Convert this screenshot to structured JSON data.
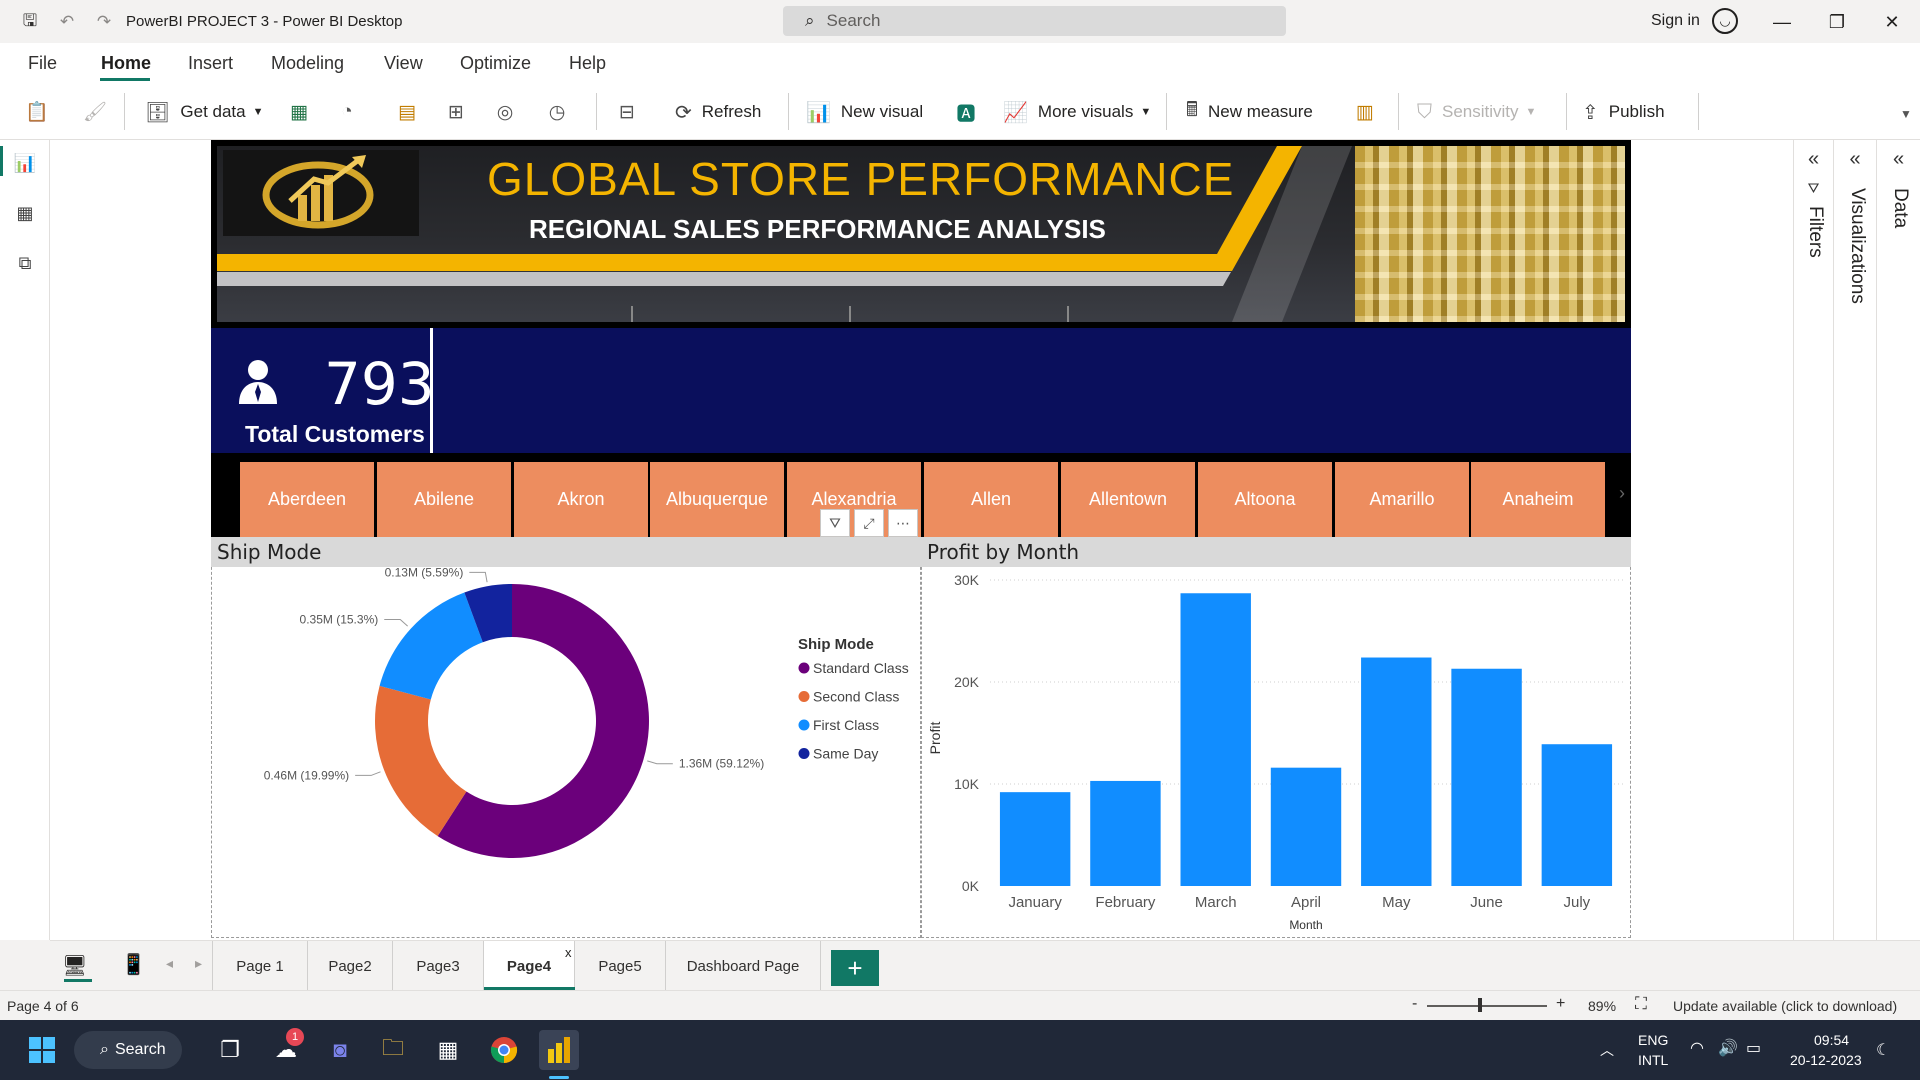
{
  "titlebar": {
    "title": "PowerBI PROJECT 3 - Power BI Desktop",
    "search_placeholder": "Search",
    "sign_in": "Sign in"
  },
  "menu": {
    "tabs": [
      "File",
      "Home",
      "Insert",
      "Modeling",
      "View",
      "Optimize",
      "Help"
    ],
    "active": "Home"
  },
  "ribbon": {
    "get_data": "Get data",
    "refresh": "Refresh",
    "new_visual": "New visual",
    "more_visuals": "More visuals",
    "new_measure": "New measure",
    "sensitivity": "Sensitivity",
    "publish": "Publish"
  },
  "banner": {
    "title": "GLOBAL STORE PERFORMANCE",
    "subtitle": "REGIONAL SALES PERFORMANCE ANALYSIS",
    "colors": {
      "gold": "#f4b400",
      "dark": "#1f2023"
    }
  },
  "kpi": {
    "value": "793",
    "label": "Total Customers",
    "color": "#0a0f5c"
  },
  "slicer": {
    "cities": [
      "Aberdeen",
      "Abilene",
      "Akron",
      "Albuquerque",
      "Alexandria",
      "Allen",
      "Allentown",
      "Altoona",
      "Amarillo",
      "Anaheim"
    ],
    "button_color": "#ed8d5f"
  },
  "ship_mode": {
    "title": "Ship Mode",
    "legend_title": "Ship Mode"
  },
  "profit_chart": {
    "title": "Profit by Month"
  },
  "chart_data": [
    {
      "type": "pie",
      "title": "Ship Mode",
      "series": [
        {
          "name": "Standard Class",
          "value": 1.36,
          "label": "1.36M (59.12%)",
          "color": "#6b007b"
        },
        {
          "name": "Second Class",
          "value": 0.46,
          "label": "0.46M (19.99%)",
          "color": "#e66c37"
        },
        {
          "name": "First Class",
          "value": 0.35,
          "label": "0.35M (15.3%)",
          "color": "#118dff"
        },
        {
          "name": "Same Day",
          "value": 0.13,
          "label": "0.13M (5.59%)",
          "color": "#12239e"
        }
      ],
      "legend": "right"
    },
    {
      "type": "bar",
      "title": "Profit by Month",
      "categories": [
        "January",
        "February",
        "March",
        "April",
        "May",
        "June",
        "July"
      ],
      "values": [
        9200,
        10300,
        28700,
        11600,
        22400,
        21300,
        13900
      ],
      "xlabel": "Month",
      "ylabel": "Profit",
      "ylim": [
        0,
        30000
      ],
      "yticks": [
        "0K",
        "10K",
        "20K",
        "30K"
      ],
      "color": "#118dff",
      "grid": true
    }
  ],
  "panes": {
    "filters": "Filters",
    "visualizations": "Visualizations",
    "data": "Data"
  },
  "pages": {
    "tabs": [
      "Page 1",
      "Page2",
      "Page3",
      "Page4",
      "Page5",
      "Dashboard Page"
    ],
    "active": "Page4",
    "close": "x",
    "add": "+"
  },
  "status": {
    "page_info": "Page 4 of 6",
    "zoom": "89%",
    "zoom_minus": "-",
    "zoom_plus": "+",
    "update": "Update available (click to download)"
  },
  "taskbar": {
    "search": "Search",
    "badge": "1",
    "lang": "ENG",
    "region": "INTL",
    "time": "09:54",
    "date": "20-12-2023"
  }
}
